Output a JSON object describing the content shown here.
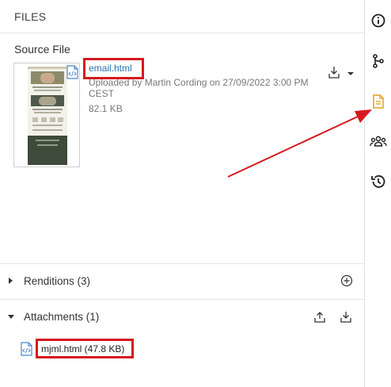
{
  "panel": {
    "title": "FILES",
    "source_file": {
      "section_label": "Source File",
      "file_name": "email.html",
      "uploaded_by": "Uploaded by Martin Cording on 27/09/2022 3:00 PM CEST",
      "size": "82.1 KB"
    },
    "renditions": {
      "label": "Renditions (3)"
    },
    "attachments": {
      "label": "Attachments (1)",
      "items": [
        {
          "label": "mjml.html (47.8 KB)"
        }
      ]
    }
  },
  "rail": {
    "items": [
      {
        "name": "info-icon"
      },
      {
        "name": "branch-icon"
      },
      {
        "name": "files-icon",
        "active": true
      },
      {
        "name": "people-icon"
      },
      {
        "name": "history-icon"
      }
    ]
  },
  "colors": {
    "accent": "#e8a93a",
    "link": "#2a6fb3",
    "highlight": "#d6181d"
  }
}
